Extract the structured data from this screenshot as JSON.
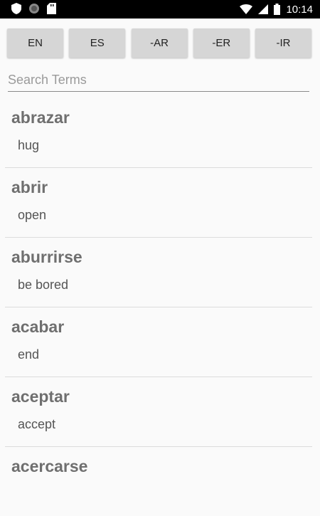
{
  "status_bar": {
    "time": "10:14",
    "icons": [
      "shield-icon",
      "circle-icon",
      "sd-card-icon",
      "wifi-icon",
      "signal-icon",
      "battery-icon"
    ]
  },
  "filters": [
    {
      "label": "EN"
    },
    {
      "label": "ES"
    },
    {
      "label": "-AR"
    },
    {
      "label": "-ER"
    },
    {
      "label": "-IR"
    }
  ],
  "search": {
    "placeholder": "Search Terms",
    "value": ""
  },
  "terms": [
    {
      "term": "abrazar",
      "translation": "hug"
    },
    {
      "term": "abrir",
      "translation": "open"
    },
    {
      "term": "aburrirse",
      "translation": "be bored"
    },
    {
      "term": "acabar",
      "translation": "end"
    },
    {
      "term": "aceptar",
      "translation": "accept"
    },
    {
      "term": "acercarse",
      "translation": ""
    }
  ]
}
